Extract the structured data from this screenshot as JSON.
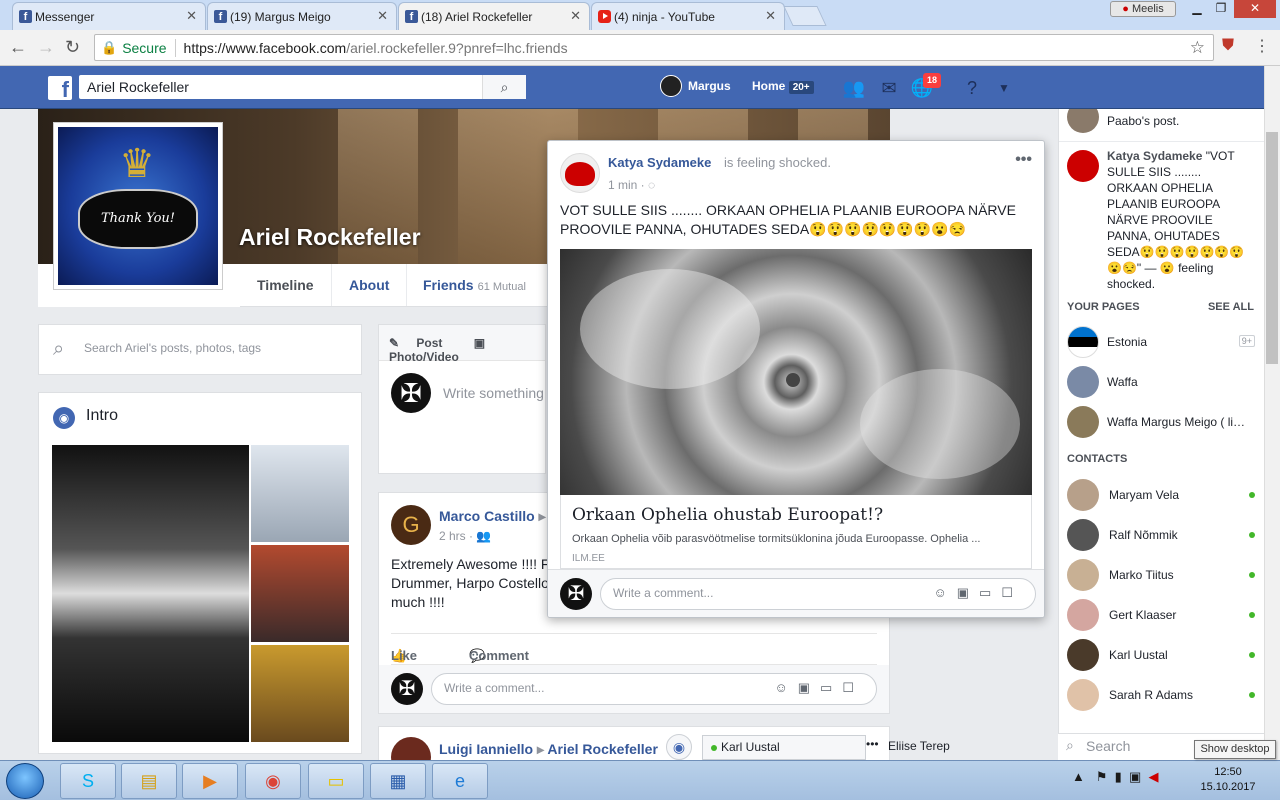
{
  "browser": {
    "tabs": [
      {
        "label": "Messenger",
        "icon": "facebook-icon"
      },
      {
        "label": "(19) Margus Meigo",
        "icon": "facebook-icon"
      },
      {
        "label": "(18) Ariel Rockefeller",
        "icon": "facebook-icon",
        "active": true
      },
      {
        "label": "(4) ninja - YouTube",
        "icon": "youtube-icon"
      }
    ],
    "profile_button": "Meelis",
    "secure_label": "Secure",
    "url_host": "https://www.facebook.com",
    "url_rest": "/ariel.rockefeller.9?pnref=lhc.friends"
  },
  "fb": {
    "search_value": "Ariel Rockefeller",
    "user_name": "Margus",
    "home_label": "Home",
    "home_count": "20+",
    "notif_count": "18",
    "brand_color": "#4267b2"
  },
  "profile": {
    "name": "Ariel Rockefeller",
    "pic_text": "Thank You!",
    "tabs": {
      "timeline": "Timeline",
      "about": "About",
      "friends": "Friends",
      "mutual": "61 Mutual"
    },
    "search_placeholder": "Search Ariel's posts, photos, tags",
    "intro_title": "Intro"
  },
  "composer": {
    "post_tab": "Post",
    "photo_tab": "Photo/Video",
    "placeholder": "Write something"
  },
  "marco_post": {
    "author": "Marco Castillo",
    "time": "2 hrs",
    "text": "Extremely Awesome !!!! F Drummer, Harpo Costello much !!!!",
    "like": "Like",
    "comment": "Comment",
    "comment_placeholder": "Write a comment..."
  },
  "luigi_post": {
    "author": "Luigi Ianniello",
    "target": "Ariel Rockefeller"
  },
  "popup": {
    "author": "Katya Sydameke",
    "feeling": "is  feeling shocked.",
    "time": "1 min",
    "text": "VOT SULLE SIIS ........ ORKAAN OPHELIA PLAANIB EUROOPA NÄRVE PROOVILE PANNA, OHUTADES SEDA😲😲😲😲😲😲😲😮😒",
    "link_title": "Orkaan Ophelia ohustab Euroopat!?",
    "link_desc": "Orkaan Ophelia võib parasvöötmelise tormitsüklonina jõuda Euroopasse. Ophelia ...",
    "link_domain": "ILM.EE",
    "comment_placeholder": "Write a comment..."
  },
  "sidebar": {
    "ticker_top": "Paabo's post.",
    "ticker_item": {
      "name": "Katya Sydameke",
      "text": "\"VOT SULLE SIIS ........ ORKAAN OPHELIA PLAANIB EUROOPA NÄRVE PROOVILE PANNA, OHUTADES SEDA😲😲😲😲😲😲😲😮😒\" — 😮 feeling shocked."
    },
    "your_pages": "YOUR PAGES",
    "see_all": "SEE ALL",
    "pages": [
      {
        "name": "Estonia",
        "badge": "9+"
      },
      {
        "name": "Waffa",
        "badge": ""
      },
      {
        "name": "Waffa Margus Meigo ( life ...",
        "badge": ""
      }
    ],
    "contacts_title": "CONTACTS",
    "contacts": [
      "Maryam Vela",
      "Ralf Nõmmik",
      "Marko Tiitus",
      "Gert Klaaser",
      "Karl Uustal",
      "Sarah R Adams"
    ],
    "chat_search": "Search"
  },
  "chat": {
    "tab1": "Karl Uustal",
    "tab2": "Eliise Terep"
  },
  "taskbar": {
    "time": "12:50",
    "date": "15.10.2017",
    "tooltip": "Show desktop"
  }
}
